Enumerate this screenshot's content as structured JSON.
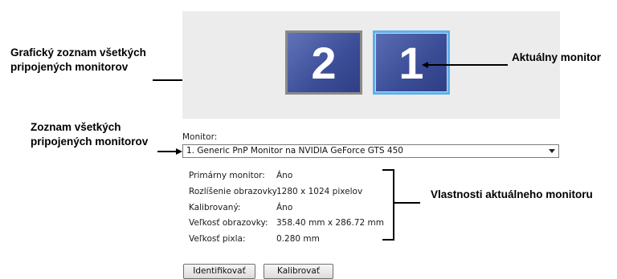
{
  "annotations": {
    "graphic_list_line1": "Grafický zoznam všetkých",
    "graphic_list_line2": "pripojených monitorov",
    "current_monitor": "Aktuálny monitor",
    "monitor_list_line1": "Zoznam všetkých",
    "monitor_list_line2": "pripojených monitorov",
    "properties": "Vlastnosti aktuálneho monitoru"
  },
  "preview": {
    "monitors": [
      {
        "number": "2"
      },
      {
        "number": "1"
      }
    ]
  },
  "monitor_select": {
    "label": "Monitor:",
    "value": "1. Generic PnP Monitor na NVIDIA GeForce GTS 450"
  },
  "properties": [
    {
      "key": "Primárny monitor:",
      "value": "Áno"
    },
    {
      "key": "Rozlíšenie obrazovky",
      "value": "1280 x 1024 pixelov"
    },
    {
      "key": "Kalibrovaný:",
      "value": "Áno"
    },
    {
      "key": "Veľkosť obrazovky:",
      "value": "358.40 mm x 286.72 mm"
    },
    {
      "key": "Veľkosť pixla:",
      "value": "0.280 mm"
    }
  ],
  "buttons": {
    "identify": "Identifikovať",
    "calibrate": "Kalibrovať"
  }
}
